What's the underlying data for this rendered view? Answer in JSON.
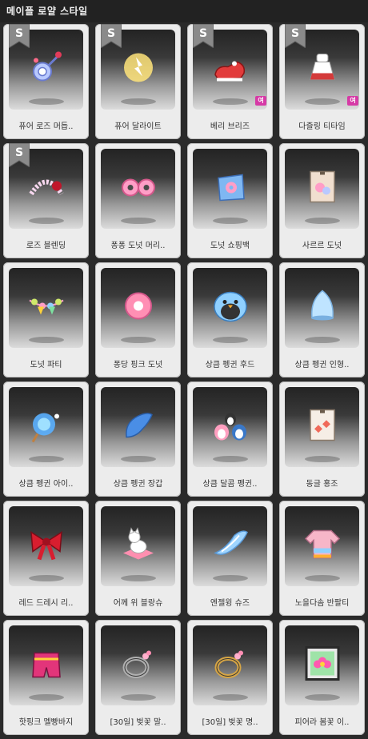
{
  "header": {
    "title": "메이플 로얄 스타일"
  },
  "badges": {
    "s": "S",
    "female": "여"
  },
  "items": [
    {
      "label": "퓨어 로즈 머듭..",
      "icon": "rose-pendant-icon",
      "s": true,
      "f": false,
      "color": "#b9c9ff"
    },
    {
      "label": "퓨어 달라이트",
      "icon": "light-orb-icon",
      "s": true,
      "f": false,
      "color": "#ffe47a"
    },
    {
      "label": "베리 브리즈",
      "icon": "red-shoe-icon",
      "s": true,
      "f": true,
      "color": "#e23b3b"
    },
    {
      "label": "다즐링 티타임",
      "icon": "tea-dress-icon",
      "s": true,
      "f": true,
      "color": "#d43a3a"
    },
    {
      "label": "로즈 블렌딩",
      "icon": "rose-halo-icon",
      "s": true,
      "f": false,
      "color": "#f7d7ef"
    },
    {
      "label": "퐁퐁 도넛 머리..",
      "icon": "donut-headband-icon",
      "s": false,
      "f": false,
      "color": "#ff9ec7"
    },
    {
      "label": "도넛 쇼핑백",
      "icon": "donut-bag-icon",
      "s": false,
      "f": false,
      "color": "#7fb7f2"
    },
    {
      "label": "사르르 도넛",
      "icon": "donut-scroll-icon",
      "s": false,
      "f": false,
      "color": "#f1dfcf"
    },
    {
      "label": "도넛 파티",
      "icon": "donut-garland-icon",
      "s": false,
      "f": false,
      "color": "#cfe86a"
    },
    {
      "label": "퐁당 핑크 도넛",
      "icon": "pink-donut-icon",
      "s": false,
      "f": false,
      "color": "#ff8fb4"
    },
    {
      "label": "상큼 펭귄 후드",
      "icon": "penguin-hood-icon",
      "s": false,
      "f": false,
      "color": "#8fd0ff"
    },
    {
      "label": "상큼 펭귄 인형..",
      "icon": "penguin-doll-icon",
      "s": false,
      "f": false,
      "color": "#bfe4ff"
    },
    {
      "label": "상큼 펭귄 아이..",
      "icon": "penguin-icecream-icon",
      "s": false,
      "f": false,
      "color": "#5ab0ff"
    },
    {
      "label": "상큼 펭귄 장갑",
      "icon": "blue-glove-icon",
      "s": false,
      "f": false,
      "color": "#4a8ee6"
    },
    {
      "label": "상큼 달콤 펭귄..",
      "icon": "penguin-trio-icon",
      "s": false,
      "f": false,
      "color": "#ff9fc0"
    },
    {
      "label": "동글 홍조",
      "icon": "blush-scroll-icon",
      "s": false,
      "f": false,
      "color": "#f06a5a"
    },
    {
      "label": "레드 드레시 리..",
      "icon": "red-ribbon-icon",
      "s": false,
      "f": false,
      "color": "#d81e2f"
    },
    {
      "label": "어께 위 블랑슈",
      "icon": "white-cat-icon",
      "s": false,
      "f": false,
      "color": "#ff8fb0"
    },
    {
      "label": "엔젤윙 슈즈",
      "icon": "angel-wing-icon",
      "s": false,
      "f": false,
      "color": "#9fd5ff"
    },
    {
      "label": "노을다솜 반팔티",
      "icon": "sunset-tee-icon",
      "s": false,
      "f": false,
      "color": "#f7b6c8"
    },
    {
      "label": "핫핑크 멜빵바지",
      "icon": "pink-overalls-icon",
      "s": false,
      "f": false,
      "color": "#e2357a"
    },
    {
      "label": "[30일] 벚꽃 말..",
      "icon": "silver-ring-icon",
      "s": false,
      "f": false,
      "color": "#b0b0b0"
    },
    {
      "label": "[30일] 벚꽃 명..",
      "icon": "gold-ring-icon",
      "s": false,
      "f": false,
      "color": "#d6a545"
    },
    {
      "label": "피어라 봄꽃 이..",
      "icon": "flower-frame-icon",
      "s": false,
      "f": false,
      "color": "#ff5ab0"
    }
  ]
}
